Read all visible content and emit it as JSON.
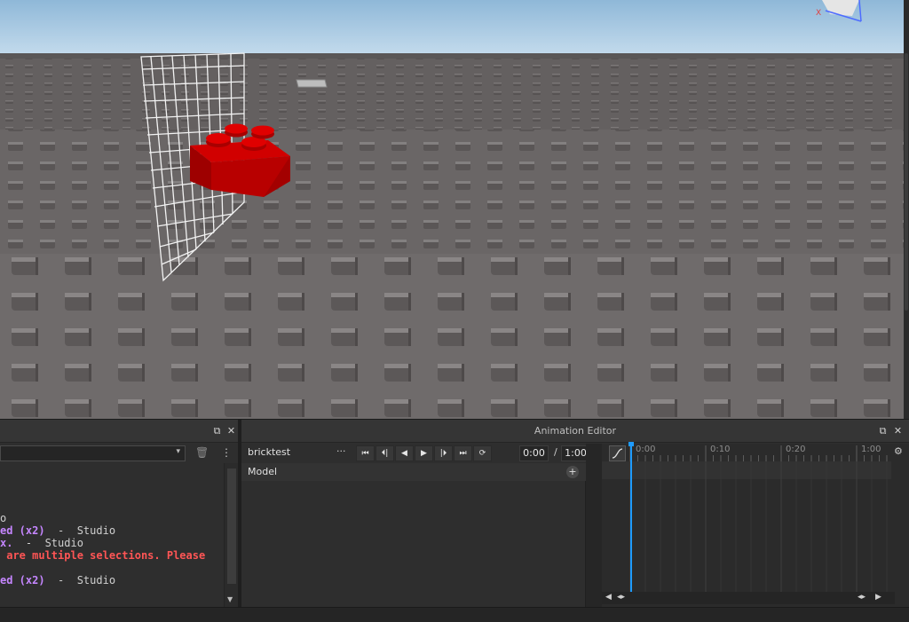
{
  "output_panel": {
    "filter_value": "",
    "log_lines": [
      {
        "segments": [
          {
            "text": "o",
            "color": "gray"
          }
        ]
      },
      {
        "segments": [
          {
            "text": "ed (x2)",
            "color": "purple"
          },
          {
            "text": "  -  Studio",
            "color": "gray"
          }
        ]
      },
      {
        "segments": [
          {
            "text": "x.",
            "color": "purple"
          },
          {
            "text": "  -  Studio",
            "color": "gray"
          }
        ]
      },
      {
        "segments": [
          {
            "text": " are multiple selections. Please",
            "color": "red"
          }
        ]
      },
      {
        "segments": [
          {
            "text": "",
            "color": "gray"
          }
        ]
      },
      {
        "segments": [
          {
            "text": "ed (x2)",
            "color": "purple"
          },
          {
            "text": "  -  Studio",
            "color": "gray"
          }
        ]
      }
    ]
  },
  "animation_editor": {
    "title": "Animation Editor",
    "rig_name": "bricktest",
    "more_label": "···",
    "current_time": "0:00",
    "time_separator": "/",
    "end_time": "1:00",
    "tracks": [
      {
        "label": "Model"
      }
    ],
    "timeline_ticks": [
      "0:00",
      "0:10",
      "0:20",
      "1:00"
    ],
    "playhead_value": "0:00"
  },
  "colors": {
    "sky": "#9fc4de",
    "ground": "#6e6b6b",
    "brick": "#c40000",
    "accent": "#1e9bff",
    "log_purple": "#c586ff",
    "log_red": "#ff5555"
  },
  "icons": {
    "float": "restore-icon",
    "close": "close-icon",
    "trash": "trash-icon",
    "first": "skip-to-start-icon",
    "prev_key": "previous-keyframe-icon",
    "reverse": "play-reverse-icon",
    "play": "play-icon",
    "next_key": "next-keyframe-icon",
    "last": "skip-to-end-icon",
    "loop": "loop-icon"
  }
}
